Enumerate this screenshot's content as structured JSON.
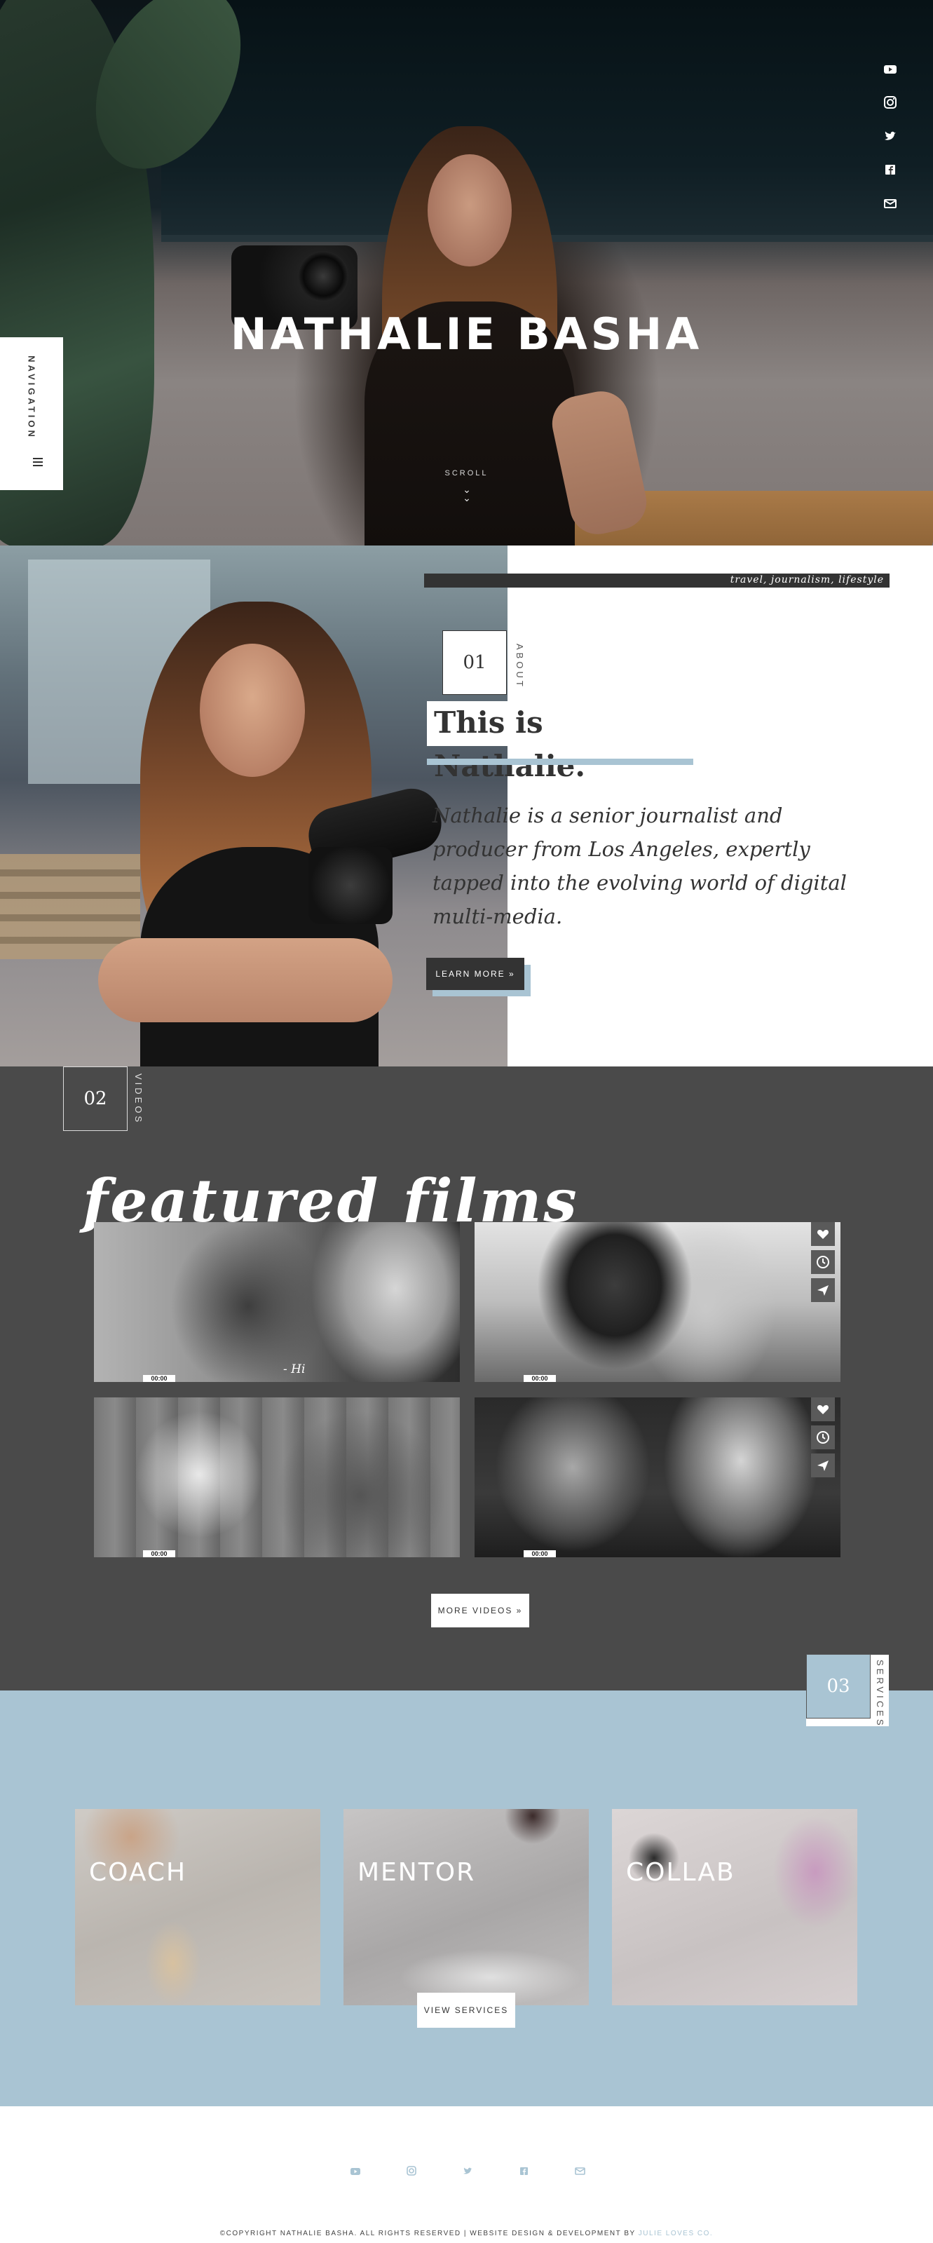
{
  "hero": {
    "title": "NATHALIE BASHA",
    "scroll_label": "SCROLL",
    "social_icons": [
      "youtube-icon",
      "instagram-icon",
      "twitter-icon",
      "facebook-icon",
      "email-icon"
    ]
  },
  "navigation": {
    "label": "NAVIGATION"
  },
  "about": {
    "tagline": "travel, journalism, lifestyle",
    "number": "01",
    "section_label": "ABOUT",
    "heading": "This is Nathalie.",
    "body": "Nathalie is a senior journalist and producer from Los Angeles, expertly tapped into the evolving world of digital multi-media.",
    "button_label": "LEARN MORE »"
  },
  "videos": {
    "number": "02",
    "section_label": "VIDEOS",
    "title": "featured films",
    "items": [
      {
        "duration": "00:00",
        "caption": "- Hi"
      },
      {
        "duration": "00:00",
        "caption": ""
      },
      {
        "duration": "00:00",
        "caption": ""
      },
      {
        "duration": "00:00",
        "caption": ""
      }
    ],
    "button_label": "MORE VIDEOS »"
  },
  "services": {
    "number": "03",
    "section_label": "SERVICES",
    "cards": [
      {
        "label": "COACH"
      },
      {
        "label": "MENTOR"
      },
      {
        "label": "COLLAB"
      }
    ],
    "button_label": "VIEW SERVICES"
  },
  "footer": {
    "social_icons": [
      "youtube-icon",
      "instagram-icon",
      "twitter-icon",
      "facebook-icon",
      "email-icon"
    ],
    "copyright": "©COPYRIGHT NATHALIE BASHA. ALL RIGHTS RESERVED | WEBSITE DESIGN & DEVELOPMENT BY",
    "designer": "JULIE LOVES CO."
  },
  "colors": {
    "accent": "#a9c4d3",
    "dark": "#333333",
    "videos_bg": "#4a4a4a"
  }
}
